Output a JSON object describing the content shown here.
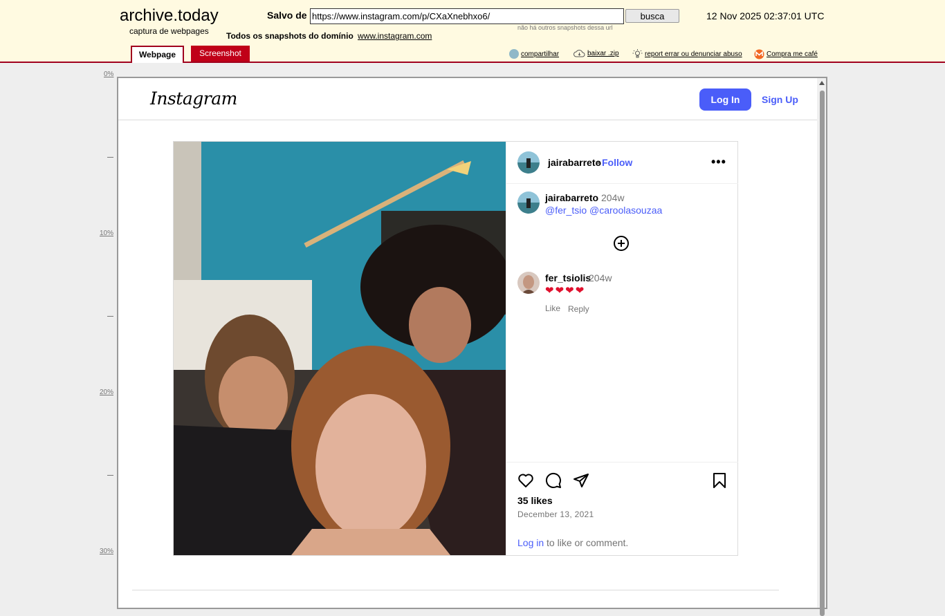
{
  "archive": {
    "logo": "archive.today",
    "tagline": "captura de webpages",
    "saved_from_label": "Salvo de",
    "url_value": "https://www.instagram.com/p/CXaXnebhxo6/",
    "search_button": "busca",
    "datetime": "12 Nov 2025 02:37:01 UTC",
    "no_other_snapshots": "não há outros snapshots dessa url",
    "all_snapshots_label": "Todos os snapshots  do domínio",
    "domain_link": "www.instagram.com",
    "tabs": {
      "webpage": "Webpage",
      "screenshot": "Screenshot"
    },
    "actions": {
      "share": "compartilhar",
      "download": "baixar .zip",
      "report": "report errar ou denunciar abuso",
      "coffee": "Compra me café"
    },
    "colors": {
      "header_bg": "#fffae1",
      "accent": "#a0001e"
    }
  },
  "ruler": {
    "marks": [
      "0%",
      "10%",
      "20%",
      "30%"
    ]
  },
  "instagram": {
    "logo": "Instagram",
    "login_button": "Log In",
    "signup_link": "Sign Up",
    "post": {
      "author": "jairabarreto",
      "follow_dot": "•",
      "follow": "Follow",
      "more_icon": "more-horizontal-icon",
      "caption_author": "jairabarreto",
      "caption_time": "204w",
      "caption_mentions": "@fer_tsio @caroolasouzaa",
      "comment": {
        "author": "fer_tsiolis",
        "time": "204w",
        "text": "❤❤❤❤",
        "like": "Like",
        "reply": "Reply"
      },
      "likes": "35 likes",
      "date": "December 13, 2021",
      "login_prompt_link": "Log in",
      "login_prompt_rest": " to like or comment."
    },
    "colors": {
      "blue": "#4a5df9",
      "muted": "#737373",
      "heart": "#e0102d"
    }
  }
}
